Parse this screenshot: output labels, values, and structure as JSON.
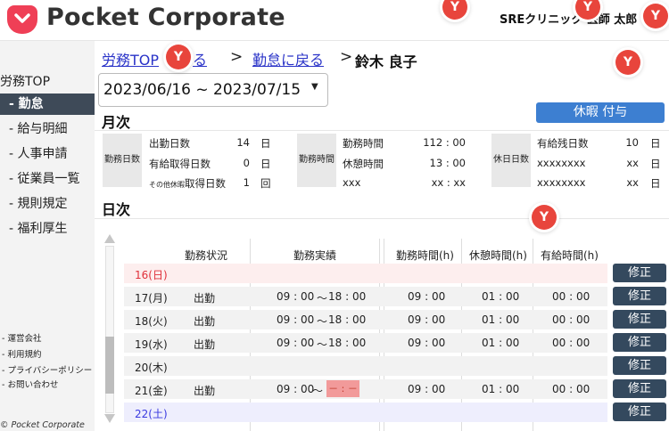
{
  "header": {
    "app_name": "Pocket Corporate",
    "user_text": "SREクリニック 医師 太郎"
  },
  "badge_text": "Y",
  "sidebar": {
    "title": "労務TOP",
    "items": [
      {
        "label": "- 勤怠",
        "active": true
      },
      {
        "label": "- 給与明細",
        "active": false
      },
      {
        "label": "- 人事申請",
        "active": false
      },
      {
        "label": "- 従業員一覧",
        "active": false
      },
      {
        "label": "- 規則規定",
        "active": false
      },
      {
        "label": "- 福利厚生",
        "active": false
      }
    ],
    "footer_links": [
      "- 運営会社",
      "- 利用規約",
      "- プライバシーポリシー",
      "- お問い合わせ"
    ],
    "copyright": "© Pocket Corporate"
  },
  "breadcrumb": {
    "top_link": "労務TOP",
    "top_link_suffix": "る",
    "separator": ">",
    "attendance_link": "勤怠に戻る",
    "current": "鈴木 良子"
  },
  "date_range": {
    "value": "2023/06/16 ~ 2023/07/15",
    "caret": "▼"
  },
  "monthly": {
    "title": "月次",
    "leave_button": "休暇 付与",
    "groups": [
      {
        "label": "勤務日数",
        "rows": [
          {
            "name": "出勤日数",
            "value": "14",
            "unit": "日"
          },
          {
            "name": "有給取得日数",
            "value": "0",
            "unit": "日"
          },
          {
            "name_small": "その他休暇",
            "name": "取得日数",
            "value": "1",
            "unit": "回"
          }
        ]
      },
      {
        "label": "勤務時間",
        "rows": [
          {
            "name": "勤務時間",
            "value": "112 : 00"
          },
          {
            "name": "休憩時間",
            "value": "13 : 00"
          },
          {
            "name": "xxx",
            "value": "xx : xx"
          }
        ]
      },
      {
        "label": "休日日数",
        "rows": [
          {
            "name": "有給残日数",
            "value": "10",
            "unit": "日"
          },
          {
            "name": "xxxxxxxx",
            "value": "xx",
            "unit": "日"
          },
          {
            "name": "xxxxxxxx",
            "value": "xx",
            "unit": "日"
          }
        ]
      }
    ]
  },
  "daily": {
    "title": "日次",
    "columns": [
      "勤務状況",
      "勤務実績",
      "勤務時間(h)",
      "休憩時間(h)",
      "有給時間(h)"
    ],
    "edit_label": "修正",
    "rows": [
      {
        "date": "16(日)",
        "status": "",
        "start": "",
        "end": "",
        "work": "",
        "break": "",
        "paid": "",
        "kind": "sunday"
      },
      {
        "date": "17(月)",
        "status": "出勤",
        "start": "09 : 00",
        "tilde": "～",
        "end": "18 : 00",
        "work": "09 : 00",
        "break": "01 : 00",
        "paid": "00 : 00",
        "kind": "weekday"
      },
      {
        "date": "18(火)",
        "status": "出勤",
        "start": "09 : 00",
        "tilde": "～",
        "end": "18 : 00",
        "work": "09 : 00",
        "break": "01 : 00",
        "paid": "00 : 00",
        "kind": "weekday"
      },
      {
        "date": "19(水)",
        "status": "出勤",
        "start": "09 : 00",
        "tilde": "～",
        "end": "18 : 00",
        "work": "09 : 00",
        "break": "01 : 00",
        "paid": "00 : 00",
        "kind": "weekday"
      },
      {
        "date": "20(木)",
        "status": "",
        "start": "",
        "end": "",
        "work": "",
        "break": "",
        "paid": "",
        "kind": "weekday"
      },
      {
        "date": "21(金)",
        "status": "出勤",
        "start": "09 : 00",
        "tilde": "～",
        "end": "－ : －",
        "work": "09 : 00",
        "break": "01 : 00",
        "paid": "00 : 00",
        "kind": "weekday",
        "missing_end": true
      },
      {
        "date": "22(土)",
        "status": "",
        "start": "",
        "end": "",
        "work": "",
        "break": "",
        "paid": "",
        "kind": "saturday"
      }
    ]
  },
  "colors": {
    "brand": "#ef3f56",
    "sidebar_active": "#3e4a58",
    "link": "#2a33c8",
    "leave_button": "#3d7fd1",
    "edit_button": "#34495e",
    "sunday_bg": "#fdeeee",
    "sunday_text": "#e0303a",
    "saturday_bg": "#eeeefd",
    "saturday_text": "#3a3ae0",
    "weekday_bg": "#f2f2f2",
    "missing": "#f29a9a"
  },
  "icons": {
    "logo": "pocket-logo-icon",
    "badge": "y-badge-icon",
    "scroll_up": "triangle-up-icon",
    "scroll_down": "triangle-down-icon"
  }
}
